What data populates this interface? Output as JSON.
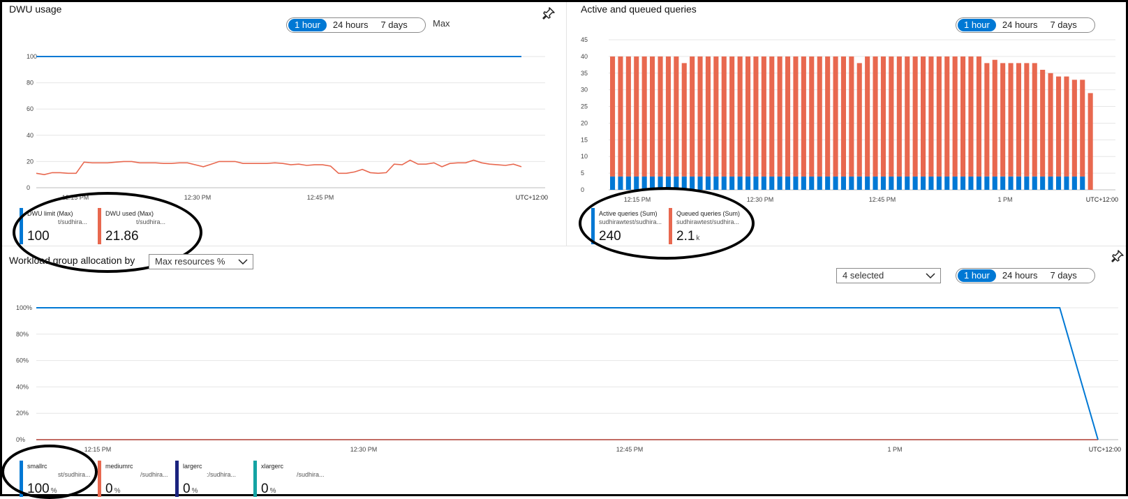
{
  "dwu": {
    "title": "DWU usage",
    "agg": "Max",
    "time_options": [
      "1 hour",
      "24 hours",
      "7 days"
    ],
    "selected_option": "1 hour",
    "timezone": "UTC+12:00",
    "legend": [
      {
        "name": "DWU limit (Max)",
        "sub": "t/sudhira...",
        "value": "100",
        "unit": "",
        "color": "#0078d4"
      },
      {
        "name": "DWU used (Max)",
        "sub": "t/sudhira...",
        "value": "21.86",
        "unit": "",
        "color": "#e8684f"
      }
    ]
  },
  "queries": {
    "title": "Active and queued queries",
    "time_options": [
      "1 hour",
      "24 hours",
      "7 days"
    ],
    "selected_option": "1 hour",
    "timezone": "UTC+12:00",
    "legend": [
      {
        "name": "Active queries (Sum)",
        "sub": "sudhirawtest/sudhira...",
        "value": "240",
        "unit": "",
        "color": "#0078d4"
      },
      {
        "name": "Queued queries (Sum)",
        "sub": "sudhirawtest/sudhira...",
        "value": "2.1",
        "unit": "k",
        "color": "#e8684f"
      }
    ]
  },
  "workload": {
    "title": "Workload group allocation by",
    "metric_select": "Max resources %",
    "series_select": "4 selected",
    "time_options": [
      "1 hour",
      "24 hours",
      "7 days"
    ],
    "selected_option": "1 hour",
    "timezone": "UTC+12:00",
    "legend": [
      {
        "name": "smallrc",
        "sub": "st/sudhira...",
        "value": "100",
        "unit": "%",
        "color": "#0078d4"
      },
      {
        "name": "mediumrc",
        "sub": "/sudhira...",
        "value": "0",
        "unit": "%",
        "color": "#e8684f"
      },
      {
        "name": "largerc",
        "sub": ":/sudhira...",
        "value": "0",
        "unit": "%",
        "color": "#1a237e"
      },
      {
        "name": "xlargerc",
        "sub": "/sudhira...",
        "value": "0",
        "unit": "%",
        "color": "#14a3a3"
      }
    ]
  },
  "icons": {
    "pin": "pin-icon",
    "chevron": "chevron-down-icon"
  },
  "chart_data": [
    {
      "type": "line",
      "yticks": [
        "100",
        "80",
        "60",
        "40",
        "20",
        "0"
      ],
      "xticks": [
        "12:15 PM",
        "12:30 PM",
        "12:45 PM"
      ],
      "ylim": [
        0,
        100
      ],
      "series": [
        {
          "name": "DWU limit (Max)",
          "color": "#0078d4",
          "values": [
            100,
            100,
            100,
            100,
            100,
            100,
            100,
            100,
            100,
            100,
            100,
            100,
            100,
            100,
            100,
            100,
            100,
            100,
            100,
            100,
            100,
            100,
            100,
            100,
            100,
            100,
            100,
            100,
            100,
            100,
            100,
            100,
            100,
            100,
            100,
            100,
            100,
            100,
            100,
            100,
            100,
            100,
            100,
            100,
            100,
            100,
            100,
            100,
            100,
            100,
            100,
            100,
            100,
            100,
            100,
            100,
            100,
            100,
            100,
            100
          ]
        },
        {
          "name": "DWU used (Max)",
          "color": "#e8684f",
          "values": [
            11,
            10,
            11.5,
            11.5,
            11,
            11,
            19.5,
            19,
            19,
            19,
            19.5,
            20,
            20,
            19,
            19,
            19,
            18.5,
            18.5,
            19,
            19,
            17.5,
            16,
            18,
            20,
            20,
            20,
            18.5,
            18.5,
            18.5,
            18.5,
            19,
            18.5,
            17.5,
            18,
            17,
            17.5,
            17.5,
            16.5,
            11,
            11,
            12,
            14,
            11.5,
            11,
            11.5,
            18,
            17.5,
            21,
            18,
            18,
            19,
            16,
            18.5,
            19,
            19,
            21,
            19,
            18,
            17.5,
            17,
            18,
            16
          ]
        }
      ]
    },
    {
      "type": "bar",
      "yticks": [
        "45",
        "40",
        "35",
        "30",
        "25",
        "20",
        "15",
        "10",
        "5",
        "0"
      ],
      "xticks": [
        "12:15 PM",
        "12:30 PM",
        "12:45 PM",
        "1 PM"
      ],
      "ylim": [
        0,
        45
      ],
      "series": [
        {
          "name": "Active queries (Sum)",
          "color": "#0078d4",
          "values": [
            4,
            4,
            4,
            4,
            4,
            4,
            4,
            4,
            4,
            4,
            4,
            4,
            4,
            4,
            4,
            4,
            4,
            4,
            4,
            4,
            4,
            4,
            4,
            4,
            4,
            4,
            4,
            4,
            4,
            4,
            4,
            4,
            4,
            4,
            4,
            4,
            4,
            4,
            4,
            4,
            4,
            4,
            4,
            4,
            4,
            4,
            4,
            4,
            4,
            4,
            4,
            4,
            4,
            4,
            4,
            4,
            4,
            4,
            4,
            4
          ]
        },
        {
          "name": "Queued queries (Sum)",
          "color": "#e8684f",
          "values": [
            36,
            36,
            36,
            36,
            36,
            36,
            36,
            36,
            36,
            34,
            36,
            36,
            36,
            36,
            36,
            36,
            36,
            36,
            36,
            36,
            36,
            36,
            36,
            36,
            36,
            36,
            36,
            36,
            36,
            36,
            36,
            34,
            36,
            36,
            36,
            36,
            36,
            36,
            36,
            36,
            36,
            36,
            36,
            36,
            36,
            36,
            36,
            34,
            35,
            34,
            34,
            34,
            34,
            34,
            32,
            31,
            30,
            30,
            29,
            29,
            29
          ]
        }
      ]
    },
    {
      "type": "line",
      "yticks": [
        "100%",
        "80%",
        "60%",
        "40%",
        "20%",
        "0%"
      ],
      "xticks": [
        "12:15 PM",
        "12:30 PM",
        "12:45 PM",
        "1 PM"
      ],
      "ylim": [
        0,
        100
      ],
      "series": [
        {
          "name": "smallrc",
          "color": "#0078d4",
          "x": [
            0,
            0.964,
            1
          ],
          "values": [
            100,
            100,
            0
          ]
        },
        {
          "name": "mediumrc",
          "color": "#e8684f",
          "x": [
            0,
            1
          ],
          "values": [
            0,
            0
          ]
        },
        {
          "name": "largerc",
          "color": "#1a237e",
          "x": [
            0,
            1
          ],
          "values": [
            0,
            0
          ]
        },
        {
          "name": "xlargerc",
          "color": "#14a3a3",
          "x": [
            0,
            1
          ],
          "values": [
            0,
            0
          ]
        }
      ]
    }
  ]
}
